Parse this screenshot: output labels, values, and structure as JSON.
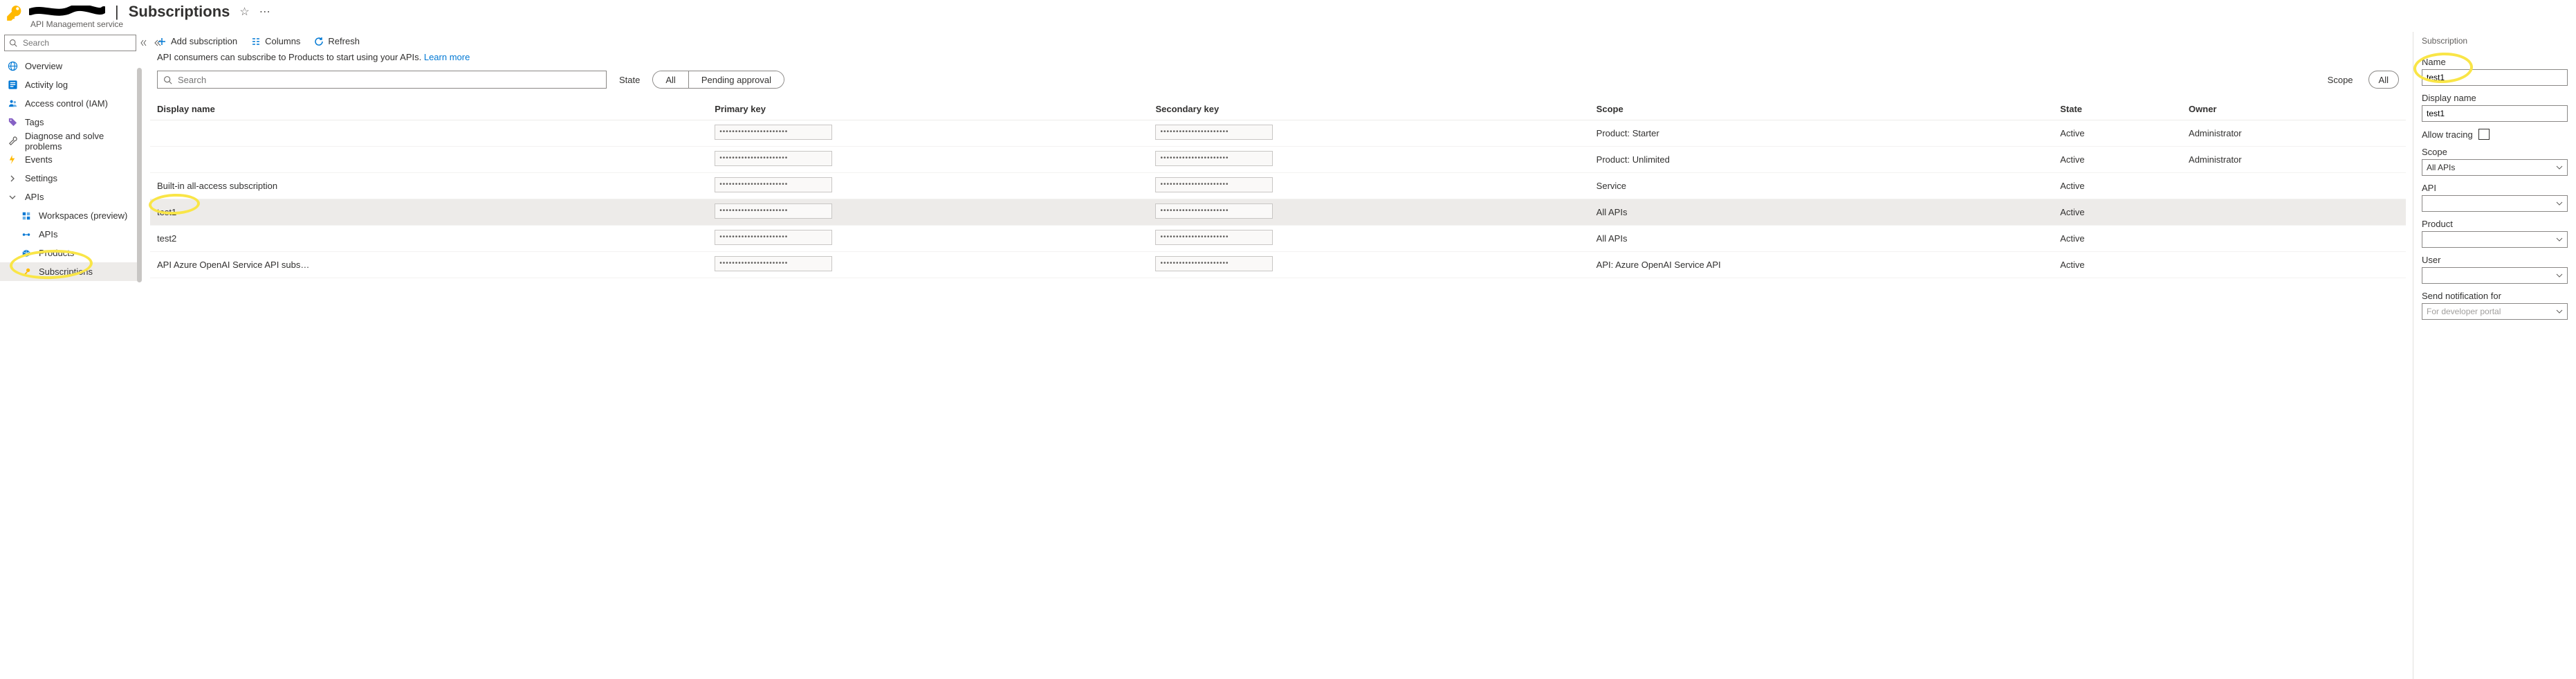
{
  "header": {
    "title": "Subscriptions",
    "subtitle": "API Management service"
  },
  "sidebar": {
    "searchPlaceholder": "Search",
    "items": [
      {
        "icon": "globe",
        "label": "Overview"
      },
      {
        "icon": "log",
        "label": "Activity log"
      },
      {
        "icon": "iam",
        "label": "Access control (IAM)"
      },
      {
        "icon": "tag",
        "label": "Tags"
      },
      {
        "icon": "diagnose",
        "label": "Diagnose and solve problems"
      },
      {
        "icon": "events",
        "label": "Events"
      },
      {
        "icon": "chev",
        "label": "Settings"
      },
      {
        "icon": "chevdown",
        "label": "APIs"
      },
      {
        "icon": "workspace",
        "label": "Workspaces (preview)",
        "sub": true
      },
      {
        "icon": "api",
        "label": "APIs",
        "sub": true
      },
      {
        "icon": "product",
        "label": "Products",
        "sub": true
      },
      {
        "icon": "key",
        "label": "Subscriptions",
        "sub": true,
        "active": true
      }
    ]
  },
  "toolbar": {
    "add": "Add subscription",
    "columns": "Columns",
    "refresh": "Refresh"
  },
  "info": {
    "text": "API consumers can subscribe to Products to start using your APIs. ",
    "link": "Learn more"
  },
  "filters": {
    "searchPlaceholder": "Search",
    "stateLabel": "State",
    "statePills": [
      "All",
      "Pending approval"
    ],
    "scopeLabel": "Scope",
    "scopePill": "All"
  },
  "table": {
    "headers": {
      "displayName": "Display name",
      "primaryKey": "Primary key",
      "secondaryKey": "Secondary key",
      "scope": "Scope",
      "state": "State",
      "owner": "Owner"
    },
    "mask": "••••••••••••••••••••••",
    "rows": [
      {
        "displayName": "",
        "scope": "Product: Starter",
        "state": "Active",
        "owner": "Administrator"
      },
      {
        "displayName": "",
        "scope": "Product: Unlimited",
        "state": "Active",
        "owner": "Administrator"
      },
      {
        "displayName": "Built-in all-access subscription",
        "scope": "Service",
        "state": "Active",
        "owner": ""
      },
      {
        "displayName": "test1",
        "scope": "All APIs",
        "state": "Active",
        "owner": "",
        "selected": true
      },
      {
        "displayName": "test2",
        "scope": "All APIs",
        "state": "Active",
        "owner": ""
      },
      {
        "displayName": "API Azure OpenAI Service API subs…",
        "scope": "API: Azure OpenAI Service API",
        "state": "Active",
        "owner": ""
      }
    ]
  },
  "panel": {
    "title": "Subscription",
    "nameLabel": "Name",
    "nameValue": "test1",
    "displayNameLabel": "Display name",
    "displayNameValue": "test1",
    "allowTracingLabel": "Allow tracing",
    "scopeLabel": "Scope",
    "scopeValue": "All APIs",
    "apiLabel": "API",
    "productLabel": "Product",
    "userLabel": "User",
    "notifyLabel": "Send notification for",
    "notifyPlaceholder": "For developer portal"
  }
}
